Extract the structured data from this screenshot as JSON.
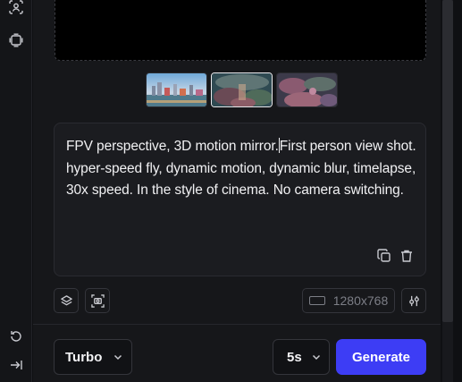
{
  "rail": {
    "icons": [
      "face-scan-icon",
      "frame-stack-icon",
      "history-icon",
      "collapse-sidebar-icon"
    ]
  },
  "prompt": {
    "text_before_caret": "FPV perspective, 3D motion mirror.",
    "text_after_caret": "First person view shot. hyper-speed fly, dynamic motion, dynamic blur, timelapse, 30x speed. In the style of cinema. No camera switching."
  },
  "thumbnails": {
    "count": 3,
    "selected_index": 1
  },
  "toolbar": {
    "resolution": "1280x768"
  },
  "footer": {
    "model": "Turbo",
    "duration": "5s",
    "generate_label": "Generate"
  },
  "colors": {
    "accent": "#3d3df5",
    "panel": "#16171a",
    "text": "#f1f1f3",
    "muted": "#7c7e86"
  }
}
